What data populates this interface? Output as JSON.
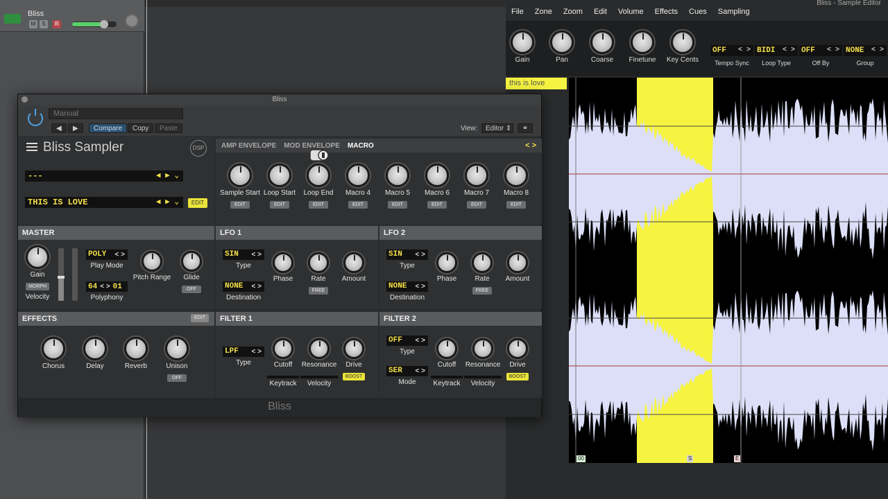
{
  "daw": {
    "track": {
      "name": "Bliss",
      "mute": "M",
      "solo": "S",
      "record": "R",
      "volume_fraction": 0.72
    }
  },
  "sample_editor": {
    "title": "Bliss - Sample Editor",
    "menu": [
      "File",
      "Zone",
      "Zoom",
      "Edit",
      "Volume",
      "Effects",
      "Cues",
      "Sampling"
    ],
    "knobs": [
      "Gain",
      "Pan",
      "Coarse",
      "Finetune",
      "Key Cents"
    ],
    "selectors": [
      {
        "value": "OFF",
        "label": "Tempo Sync"
      },
      {
        "value": "BIDI",
        "label": "Loop Type"
      },
      {
        "value": "OFF",
        "label": "Off By"
      },
      {
        "value": "NONE",
        "label": "Group"
      }
    ],
    "zone_name": "this is love",
    "markers": {
      "start": "00",
      "loop_start": "S",
      "loop_end": "E"
    },
    "colors": {
      "waveform": "#dcdff7",
      "zone": "#f6f440"
    }
  },
  "plugin": {
    "window_title": "Bliss",
    "preset": "Manual",
    "nav_prev": "◀",
    "nav_next": "▶",
    "compare": "Compare",
    "copy": "Copy",
    "paste": "Paste",
    "view_label": "View:",
    "view_value": "Editor ⇕",
    "link_icon": "⚭",
    "brand": "Bliss Sampler",
    "dsp": "DSP",
    "program_line1": "---",
    "program_line2": "THIS IS LOVE",
    "edit": "EDIT",
    "arrows": "◀ ▶ ⌄",
    "tabs": {
      "amp": "AMP ENVELOPE",
      "mod": "MOD ENVELOPE",
      "macro": "MACRO",
      "nav": "< >"
    },
    "macros": [
      {
        "label": "Sample Start",
        "button": "EDIT"
      },
      {
        "label": "Loop Start",
        "button": "EDIT"
      },
      {
        "label": "Loop End",
        "button": "EDIT"
      },
      {
        "label": "Macro 4",
        "button": "EDIT"
      },
      {
        "label": "Macro 5",
        "button": "EDIT"
      },
      {
        "label": "Macro 6",
        "button": "EDIT"
      },
      {
        "label": "Macro 7",
        "button": "EDIT"
      },
      {
        "label": "Macro 8",
        "button": "EDIT"
      }
    ],
    "master": {
      "title": "MASTER",
      "gain": "Gain",
      "morph": "MORPH",
      "velocity": "Velocity",
      "play_mode_value": "POLY",
      "play_mode_label": "Play Mode",
      "polyphony_value": "64",
      "polyphony_value2": "01",
      "polyphony_label": "Polyphony",
      "pitch_range": "Pitch Range",
      "glide": "Glide",
      "glide_button": "OFF",
      "velocity_level": 0.45
    },
    "lfo1": {
      "title": "LFO 1",
      "type_value": "SIN",
      "type_label": "Type",
      "dest_value": "NONE",
      "dest_label": "Destination",
      "phase": "Phase",
      "rate": "Rate",
      "rate_button": "FREE",
      "amount": "Amount"
    },
    "lfo2": {
      "title": "LFO 2",
      "type_value": "SIN",
      "type_label": "Type",
      "dest_value": "NONE",
      "dest_label": "Destination",
      "phase": "Phase",
      "rate": "Rate",
      "rate_button": "FREE",
      "amount": "Amount"
    },
    "effects": {
      "title": "EFFECTS",
      "edit": "EDIT",
      "chorus": "Chorus",
      "delay": "Delay",
      "reverb": "Reverb",
      "unison": "Unison",
      "unison_button": "OFF"
    },
    "filter1": {
      "title": "FILTER 1",
      "type_value": "LPF",
      "type_label": "Type",
      "cutoff": "Cutoff",
      "resonance": "Resonance",
      "drive": "Drive",
      "keytrack": "Keytrack",
      "velocity": "Velocity",
      "boost": "BOOST"
    },
    "filter2": {
      "title": "FILTER 2",
      "type_value": "OFF",
      "type_label": "Type",
      "mode_value": "SER",
      "mode_label": "Mode",
      "cutoff": "Cutoff",
      "resonance": "Resonance",
      "drive": "Drive",
      "keytrack": "Keytrack",
      "velocity": "Velocity",
      "boost": "BOOST"
    },
    "footer": "Bliss"
  }
}
